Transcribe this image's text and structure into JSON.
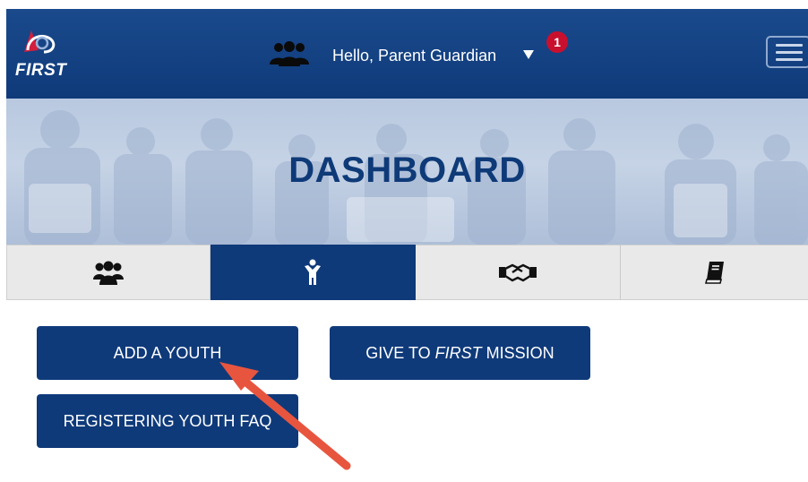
{
  "header": {
    "logo_text": "FIRST",
    "greeting": "Hello, Parent Guardian",
    "notification_count": "1",
    "brand_color": "#0f3a7a",
    "badge_color": "#c8102e"
  },
  "banner": {
    "title": "DASHBOARD"
  },
  "tabs": [
    {
      "icon": "people-group-icon",
      "active": false
    },
    {
      "icon": "youth-person-icon",
      "active": true
    },
    {
      "icon": "handshake-icon",
      "active": false
    },
    {
      "icon": "book-icon",
      "active": false
    }
  ],
  "actions": {
    "add_youth": "ADD A YOUTH",
    "give_prefix": "GIVE TO ",
    "give_emphasis": "FIRST",
    "give_suffix": " MISSION",
    "faq": "REGISTERING YOUTH FAQ"
  },
  "annotation": {
    "arrow_color": "#e8553f"
  }
}
